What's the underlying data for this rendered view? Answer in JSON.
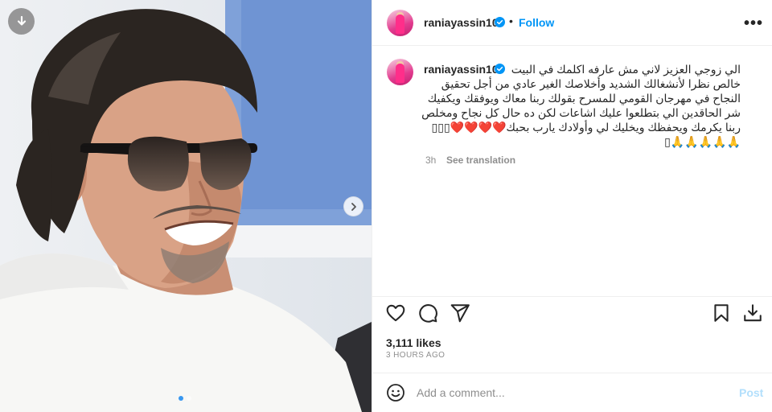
{
  "post": {
    "username": "raniayassin10",
    "follow_label": "Follow",
    "separator": "•",
    "more_label": "•••",
    "caption": "الي زوجي العزيز لاني مش عارفه اكلمك في البيت\nخالص نظرا لأنشغالك الشديد وأخلاصك الغير عادي من أجل تحقيق\nالنجاح في مهرجان القومي للمسرح بقولك ربنا معاك ويوفقك ويكفيك\nشر الحاقدين الي بتطلعوا عليك اشاعات لكن ده حال كل نجاح ومخلص\nربنا يكرمك ويحفظك ويخليك لي وأولادك يارب بحبك❤️❤️❤️❤️▯▯▯\n🙏🙏🙏🙏🙏▯",
    "time_short": "3h",
    "see_translation": "See translation",
    "likes": "3,111 likes",
    "time_ago": "3 HOURS AGO"
  },
  "comment": {
    "placeholder": "Add a comment...",
    "post_label": "Post"
  },
  "carousel": {
    "current": 1,
    "total": 2
  },
  "icons": {
    "download": "download-circle-icon",
    "next": "chevron-right-icon",
    "verified": "verified-badge-icon",
    "like": "heart-icon",
    "comment": "comment-bubble-icon",
    "share": "paper-plane-icon",
    "save": "bookmark-icon",
    "save_to_device": "download-tray-icon",
    "emoji": "smiley-icon"
  },
  "colors": {
    "accent": "#0095f6",
    "muted": "#8e8e8e",
    "post_disabled": "#b2dffc",
    "dot_active": "#3897f0"
  }
}
